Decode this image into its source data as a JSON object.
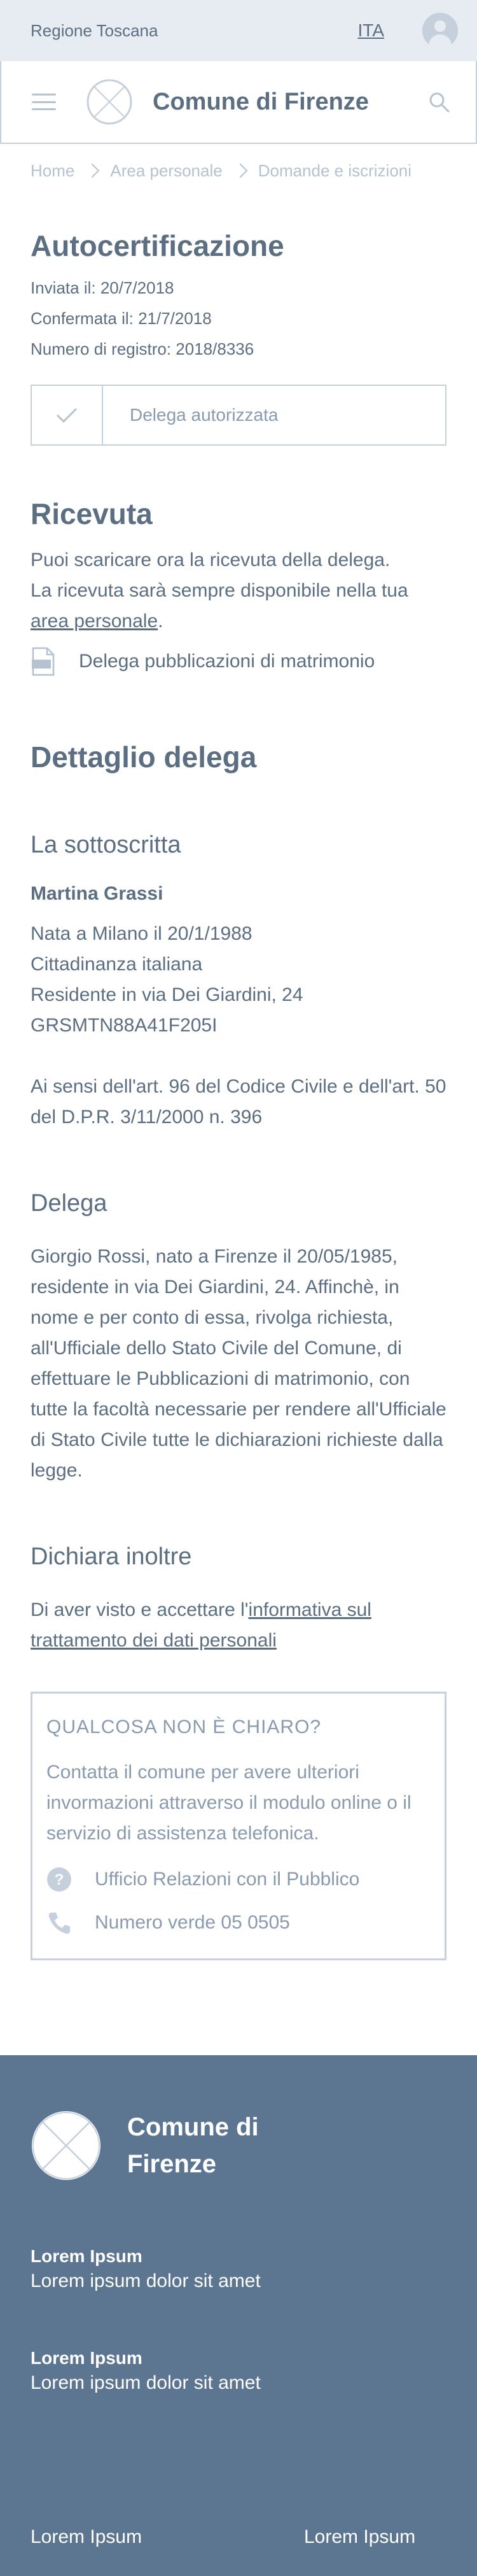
{
  "topbar": {
    "region": "Regione Toscana",
    "language": "ITA"
  },
  "header": {
    "brand": "Comune di Firenze"
  },
  "breadcrumb": [
    "Home",
    "Area personale",
    "Domande e iscrizioni"
  ],
  "page": {
    "title": "Autocertificazione",
    "sent": "Inviata il: 20/7/2018",
    "confirmed": "Confermata il: 21/7/2018",
    "registry": "Numero di registro: 2018/8336",
    "status": "Delega autorizzata"
  },
  "receipt": {
    "title": "Ricevuta",
    "line1": "Puoi scaricare ora la ricevuta della delega.",
    "line2": "La ricevuta sarà sempre disponibile nella tua",
    "link": "area personale",
    "link_suffix": ".",
    "file": "Delega pubblicazioni di matrimonio"
  },
  "detail": {
    "title": "Dettaglio delega",
    "undersigned_title": "La sottoscritta",
    "name": "Martina Grassi",
    "birth": "Nata a Milano il 20/1/1988",
    "citizenship": "Cittadinanza italiana",
    "residence": "Residente in via Dei Giardini, 24",
    "fiscal_code": "GRSMTN88A41F205I",
    "legal": "Ai sensi dell'art. 96 del Codice Civile e dell'art. 50 del D.P.R. 3/11/2000 n. 396",
    "delega_title": "Delega",
    "delega_text": "Giorgio Rossi, nato a Firenze il 20/05/1985, residente in via Dei Giardini, 24. Affinchè, in nome e per conto di essa, rivolga richiesta, all'Ufficiale dello Stato Civile del Comune, di effettuare le Pubblicazioni di matrimonio, con tutte la facoltà necessarie per rendere all'Ufficiale di Stato Civile tutte le dichiarazioni richieste dalla legge.",
    "declares_title": "Dichiara inoltre",
    "declares_prefix": "Di aver visto e accettare l'",
    "declares_link": "informativa sul trattamento dei dati personali"
  },
  "help": {
    "title": "QUALCOSA NON È CHIARO?",
    "text": "Contatta il comune per avere ulteriori invormazioni attraverso il modulo online o il servizio di assistenza telefonica.",
    "office": "Ufficio Relazioni con il Pubblico",
    "phone": "Numero verde 05 0505"
  },
  "footer": {
    "brand": "Comune di Firenze",
    "blocks": [
      {
        "title": "Lorem Ipsum",
        "text": "Lorem ipsum dolor sit amet"
      },
      {
        "title": "Lorem Ipsum",
        "text": "Lorem ipsum dolor sit amet"
      }
    ],
    "bottom_links": [
      "Lorem Ipsum",
      "Lorem Ipsum"
    ]
  },
  "colors": {
    "primary": "#5c6f82",
    "muted": "#8a9bb0",
    "border": "#c5d0dc",
    "footer_bg": "#5c7590",
    "topbar_bg": "#e6ecf2"
  },
  "icons": [
    "user-avatar-icon",
    "hamburger-menu-icon",
    "crest-logo-icon",
    "search-icon",
    "check-icon",
    "pdf-file-icon",
    "question-circle-icon",
    "phone-icon"
  ]
}
